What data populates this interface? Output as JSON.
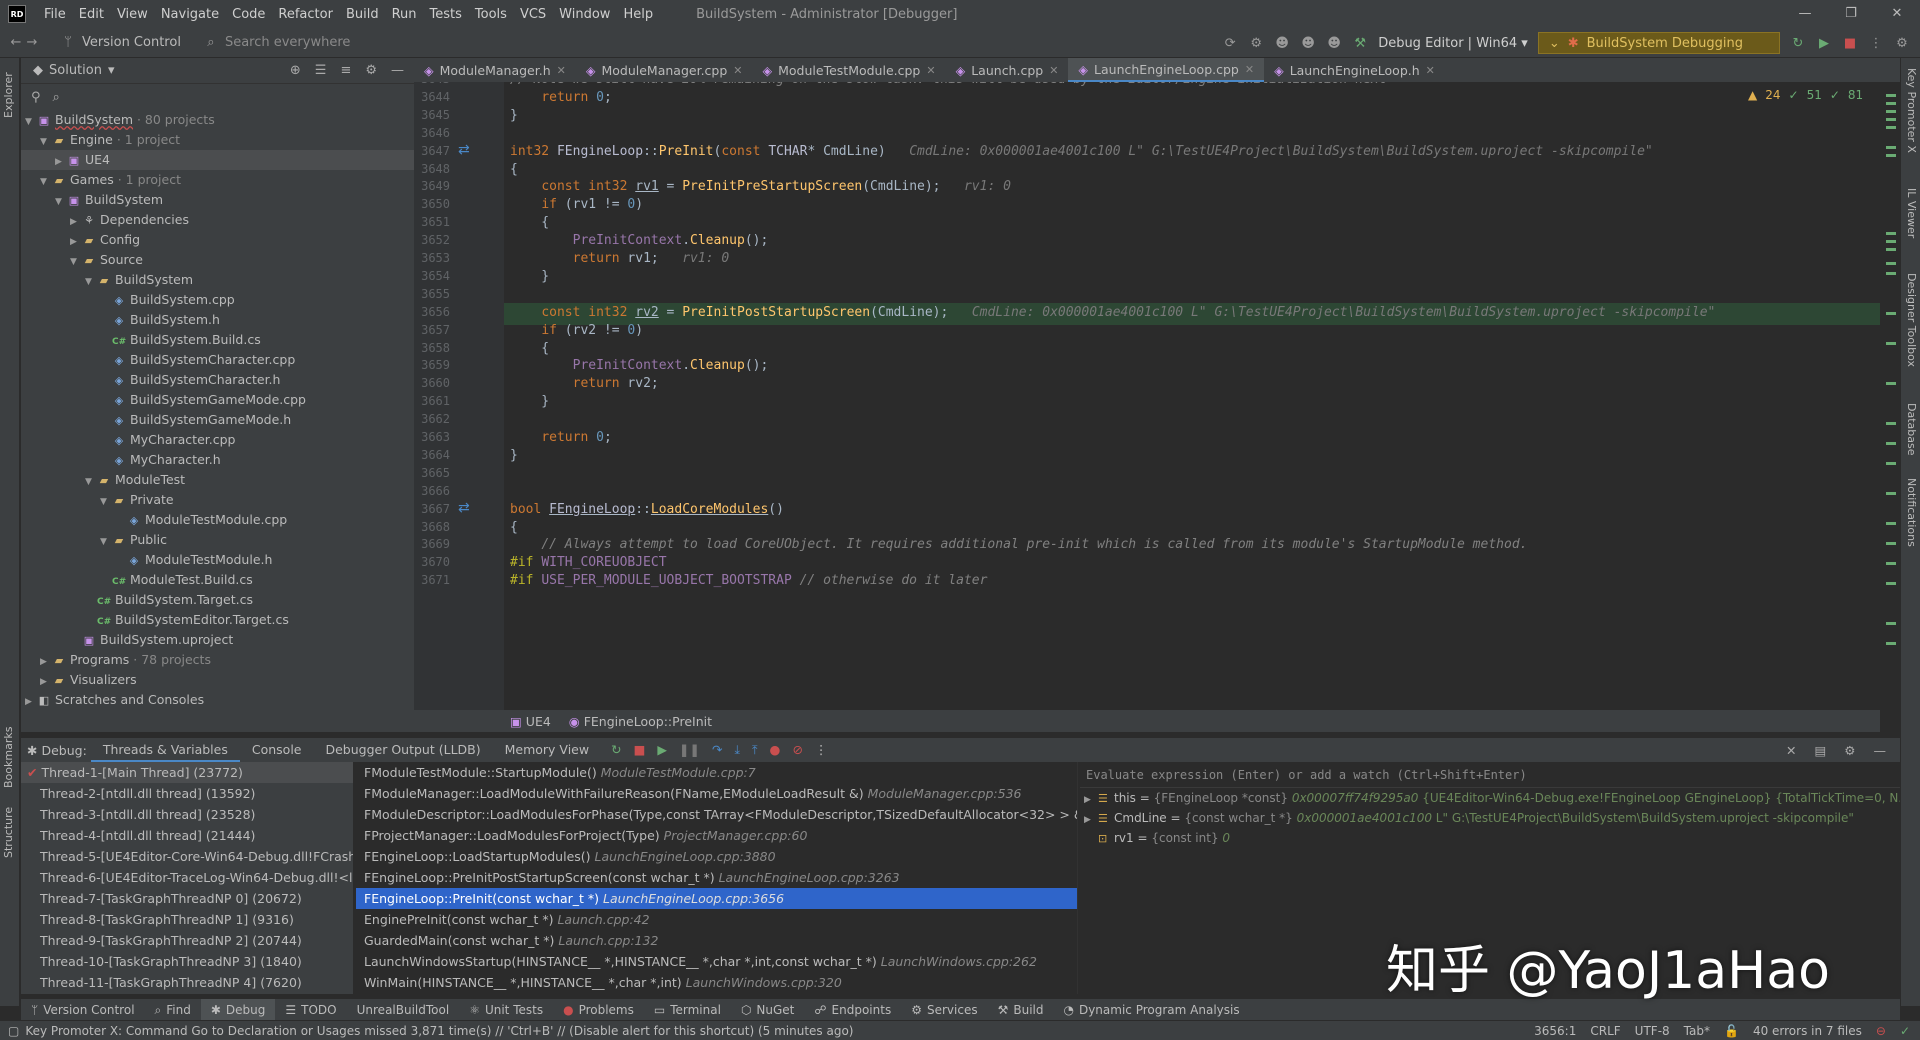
{
  "app": {
    "logo_text": "RD",
    "menu": [
      "File",
      "Edit",
      "View",
      "Navigate",
      "Code",
      "Refactor",
      "Build",
      "Run",
      "Tests",
      "Tools",
      "VCS",
      "Window",
      "Help"
    ],
    "window_title": "BuildSystem - Administrator [Debugger]",
    "win_min": "—",
    "win_max": "❐",
    "win_close": "✕"
  },
  "toolbar": {
    "version_control": "Version Control",
    "search_placeholder": "Search everywhere",
    "run_config": "Debug Editor | Win64",
    "debug_config": "BuildSystem Debugging"
  },
  "left_strip": {
    "explorer": "Explorer",
    "bookmarks": "Bookmarks",
    "structure": "Structure"
  },
  "right_strip": {
    "key_promoter": "Key Promoter X",
    "il_viewer": "IL Viewer",
    "designer": "Designer Toolbox",
    "database": "Database",
    "notifications": "Notifications"
  },
  "solution": {
    "title": "Solution",
    "tree": [
      {
        "depth": 0,
        "arrow": "v",
        "icon": "proj",
        "label": "BuildSystem",
        "hint": "· 80 projects",
        "underline": true
      },
      {
        "depth": 1,
        "arrow": "v",
        "icon": "folder",
        "label": "Engine",
        "hint": "· 1 project"
      },
      {
        "depth": 2,
        "arrow": ">",
        "icon": "proj",
        "label": "UE4",
        "hint": "",
        "selected": true
      },
      {
        "depth": 1,
        "arrow": "v",
        "icon": "folder",
        "label": "Games",
        "hint": "· 1 project"
      },
      {
        "depth": 2,
        "arrow": "v",
        "icon": "proj",
        "label": "BuildSystem",
        "hint": ""
      },
      {
        "depth": 3,
        "arrow": ">",
        "icon": "dep",
        "label": "Dependencies",
        "hint": ""
      },
      {
        "depth": 3,
        "arrow": ">",
        "icon": "folder",
        "label": "Config",
        "hint": ""
      },
      {
        "depth": 3,
        "arrow": "v",
        "icon": "folder",
        "label": "Source",
        "hint": ""
      },
      {
        "depth": 4,
        "arrow": "v",
        "icon": "folder",
        "label": "BuildSystem",
        "hint": ""
      },
      {
        "depth": 5,
        "arrow": "",
        "icon": "cpp",
        "label": "BuildSystem.cpp",
        "hint": ""
      },
      {
        "depth": 5,
        "arrow": "",
        "icon": "cpp",
        "label": "BuildSystem.h",
        "hint": ""
      },
      {
        "depth": 5,
        "arrow": "",
        "icon": "cs",
        "label": "BuildSystem.Build.cs",
        "hint": ""
      },
      {
        "depth": 5,
        "arrow": "",
        "icon": "cpp",
        "label": "BuildSystemCharacter.cpp",
        "hint": ""
      },
      {
        "depth": 5,
        "arrow": "",
        "icon": "cpp",
        "label": "BuildSystemCharacter.h",
        "hint": ""
      },
      {
        "depth": 5,
        "arrow": "",
        "icon": "cpp",
        "label": "BuildSystemGameMode.cpp",
        "hint": ""
      },
      {
        "depth": 5,
        "arrow": "",
        "icon": "cpp",
        "label": "BuildSystemGameMode.h",
        "hint": ""
      },
      {
        "depth": 5,
        "arrow": "",
        "icon": "cpp",
        "label": "MyCharacter.cpp",
        "hint": ""
      },
      {
        "depth": 5,
        "arrow": "",
        "icon": "cpp",
        "label": "MyCharacter.h",
        "hint": ""
      },
      {
        "depth": 4,
        "arrow": "v",
        "icon": "folder",
        "label": "ModuleTest",
        "hint": ""
      },
      {
        "depth": 5,
        "arrow": "v",
        "icon": "folder",
        "label": "Private",
        "hint": ""
      },
      {
        "depth": 6,
        "arrow": "",
        "icon": "cpp",
        "label": "ModuleTestModule.cpp",
        "hint": ""
      },
      {
        "depth": 5,
        "arrow": "v",
        "icon": "folder",
        "label": "Public",
        "hint": ""
      },
      {
        "depth": 6,
        "arrow": "",
        "icon": "cpp",
        "label": "ModuleTestModule.h",
        "hint": ""
      },
      {
        "depth": 5,
        "arrow": "",
        "icon": "cs",
        "label": "ModuleTest.Build.cs",
        "hint": ""
      },
      {
        "depth": 4,
        "arrow": "",
        "icon": "cs",
        "label": "BuildSystem.Target.cs",
        "hint": ""
      },
      {
        "depth": 4,
        "arrow": "",
        "icon": "cs",
        "label": "BuildSystemEditor.Target.cs",
        "hint": ""
      },
      {
        "depth": 3,
        "arrow": "",
        "icon": "proj",
        "label": "BuildSystem.uproject",
        "hint": ""
      },
      {
        "depth": 1,
        "arrow": ">",
        "icon": "folder",
        "label": "Programs",
        "hint": "· 78 projects"
      },
      {
        "depth": 1,
        "arrow": ">",
        "icon": "folder",
        "label": "Visualizers",
        "hint": ""
      },
      {
        "depth": 0,
        "arrow": ">",
        "icon": "scratch",
        "label": "Scratches and Consoles",
        "hint": ""
      }
    ]
  },
  "editor_tabs": [
    {
      "label": "ModuleManager.h",
      "active": false
    },
    {
      "label": "ModuleManager.cpp",
      "active": false
    },
    {
      "label": "ModuleTestModule.cpp",
      "active": false
    },
    {
      "label": "Launch.cpp",
      "active": false
    },
    {
      "label": "LaunchEngineLoop.cpp",
      "active": true
    },
    {
      "label": "LaunchEngineLoop.h",
      "active": false
    }
  ],
  "inspection": {
    "warnings": "24",
    "weak": "51",
    "typos": "81"
  },
  "code_lines": [
    {
      "n": "3643",
      "html": "<span class=\"cm\">// Note we still have 20% remaining on the slow task: this will be used by the Editor/Engine initialization next</span>"
    },
    {
      "n": "3644",
      "html": "    <span class=\"kw\">return</span> <span class=\"num\">0</span>;"
    },
    {
      "n": "3645",
      "html": "}"
    },
    {
      "n": "3646",
      "html": ""
    },
    {
      "n": "3647",
      "html": "<span class=\"kw\">int32</span> <span class=\"ty\">FEngineLoop</span>::<span class=\"fn\">PreInit</span>(<span class=\"kw\">const</span> <span class=\"ty\">TCHAR</span>* CmdLine)   <span class=\"hint-inline\">CmdLine: 0x000001ae4001c100 L\" G:\\TestUE4Project\\BuildSystem\\BuildSystem.uproject -skipcompile\"</span>"
    },
    {
      "n": "3648",
      "html": "{"
    },
    {
      "n": "3649",
      "html": "    <span class=\"kw\">const</span> <span class=\"kw\">int32</span> <u>rv1</u> = <span class=\"fn\">PreInitPreStartupScreen</span>(CmdLine);   <span class=\"hint-inline\">rv1: 0</span>"
    },
    {
      "n": "3650",
      "html": "    <span class=\"kw\">if</span> (rv1 != <span class=\"num\">0</span>)"
    },
    {
      "n": "3651",
      "html": "    {"
    },
    {
      "n": "3652",
      "html": "        <span class=\"mc\">PreInitContext</span>.<span class=\"fn\">Cleanup</span>();"
    },
    {
      "n": "3653",
      "html": "        <span class=\"kw\">return</span> rv1;   <span class=\"hint-inline\">rv1: 0</span>"
    },
    {
      "n": "3654",
      "html": "    }"
    },
    {
      "n": "3655",
      "html": ""
    },
    {
      "n": "3656",
      "html": "    <span class=\"kw\">const</span> <span class=\"kw\">int32</span> <u>rv2</u> = <span class=\"fn\">PreInitPostStartupScreen</span>(CmdLine);   <span class=\"hint-inline\">CmdLine: 0x000001ae4001c100 L\" G:\\TestUE4Project\\BuildSystem\\BuildSystem.uproject -skipcompile\"</span>",
      "current": true
    },
    {
      "n": "3657",
      "html": "    <span class=\"kw\">if</span> (rv2 != <span class=\"num\">0</span>)"
    },
    {
      "n": "3658",
      "html": "    {"
    },
    {
      "n": "3659",
      "html": "        <span class=\"mc\">PreInitContext</span>.<span class=\"fn\">Cleanup</span>();"
    },
    {
      "n": "3660",
      "html": "        <span class=\"kw\">return</span> rv2;"
    },
    {
      "n": "3661",
      "html": "    }"
    },
    {
      "n": "3662",
      "html": ""
    },
    {
      "n": "3663",
      "html": "    <span class=\"kw\">return</span> <span class=\"num\">0</span>;"
    },
    {
      "n": "3664",
      "html": "}"
    },
    {
      "n": "3665",
      "html": ""
    },
    {
      "n": "3666",
      "html": ""
    },
    {
      "n": "3667",
      "html": "<span class=\"kw\">bool</span> <u><span class=\"ty\">FEngineLoop</span></u>::<u><span class=\"fn\">LoadCoreModules</span></u>()"
    },
    {
      "n": "3668",
      "html": "{"
    },
    {
      "n": "3669",
      "html": "    <span class=\"cm\">// Always attempt to load CoreUObject. It requires additional pre-init which is called from its module's StartupModule method.</span>"
    },
    {
      "n": "3670",
      "html": "<span class=\"pp\">#if</span> <span class=\"mc\">WITH_COREUOBJECT</span>"
    },
    {
      "n": "3671",
      "html": "<span class=\"pp\">#if</span> <span class=\"mc\">USE_PER_MODULE_UOBJECT_BOOTSTRAP</span> <span class=\"cm\">// otherwise do it later</span>"
    }
  ],
  "breadcrumb": {
    "project": "UE4",
    "function": "FEngineLoop::PreInit"
  },
  "debug": {
    "label": "Debug:",
    "tabs": [
      "Threads & Variables",
      "Console",
      "Debugger Output (LLDB)",
      "Memory View"
    ],
    "threads": [
      "Thread-1-[Main Thread] (23772)",
      "Thread-2-[ntdll.dll thread] (13592)",
      "Thread-3-[ntdll.dll thread] (23528)",
      "Thread-4-[ntdll.dll thread] (21444)",
      "Thread-5-[UE4Editor-Core-Win64-Debug.dll!FCrashRe",
      "Thread-6-[UE4Editor-TraceLog-Win64-Debug.dll!<lar",
      "Thread-7-[TaskGraphThreadNP 0] (20672)",
      "Thread-8-[TaskGraphThreadNP 1] (9316)",
      "Thread-9-[TaskGraphThreadNP 2] (20744)",
      "Thread-10-[TaskGraphThreadNP 3] (1840)",
      "Thread-11-[TaskGraphThreadNP 4] (7620)"
    ],
    "frames": [
      {
        "fn": "FModuleTestModule::StartupModule()",
        "loc": "ModuleTestModule.cpp:7"
      },
      {
        "fn": "FModuleManager::LoadModuleWithFailureReason(FName,EModuleLoadResult &)",
        "loc": "ModuleManager.cpp:536"
      },
      {
        "fn": "FModuleDescriptor::LoadModulesForPhase(Type,const TArray<FModuleDescriptor,TSizedDefaultAllocator<32> > &,TMap",
        "loc": ""
      },
      {
        "fn": "FProjectManager::LoadModulesForProject(Type)",
        "loc": "ProjectManager.cpp:60"
      },
      {
        "fn": "FEngineLoop::LoadStartupModules()",
        "loc": "LaunchEngineLoop.cpp:3880"
      },
      {
        "fn": "FEngineLoop::PreInitPostStartupScreen(const wchar_t *)",
        "loc": "LaunchEngineLoop.cpp:3263"
      },
      {
        "fn": "FEngineLoop::PreInit(const wchar_t *)",
        "loc": "LaunchEngineLoop.cpp:3656",
        "selected": true
      },
      {
        "fn": "EnginePreInit(const wchar_t *)",
        "loc": "Launch.cpp:42"
      },
      {
        "fn": "GuardedMain(const wchar_t *)",
        "loc": "Launch.cpp:132"
      },
      {
        "fn": "LaunchWindowsStartup(HINSTANCE__ *,HINSTANCE__ *,char *,int,const wchar_t *)",
        "loc": "LaunchWindows.cpp:262"
      },
      {
        "fn": "WinMain(HINSTANCE__ *,HINSTANCE__ *,char *,int)",
        "loc": "LaunchWindows.cpp:320"
      }
    ],
    "eval_placeholder": "Evaluate expression (Enter) or add a watch (Ctrl+Shift+Enter)",
    "variables": [
      {
        "arrow": ">",
        "name": "this",
        "type": "{FEngineLoop *const}",
        "value": "0x00007ff74f9295a0",
        "extra": "{UE4Editor-Win64-Debug.exe!FEngineLoop GEngineLoop} {TotalTickTime=0, N...",
        "link": "View"
      },
      {
        "arrow": ">",
        "name": "CmdLine",
        "type": "{const wchar_t *}",
        "value": "0x000001ae4001c100",
        "extra": "L\" G:\\TestUE4Project\\BuildSystem\\BuildSystem.uproject -skipcompile\"",
        "link": ""
      },
      {
        "arrow": "",
        "name": "rv1",
        "type": "{const int}",
        "value": "0",
        "extra": "",
        "link": ""
      }
    ]
  },
  "bottom_tabs": [
    "Version Control",
    "Find",
    "Debug",
    "TODO",
    "UnrealBuildTool",
    "Unit Tests",
    "Problems",
    "Terminal",
    "NuGet",
    "Endpoints",
    "Services",
    "Build",
    "Dynamic Program Analysis"
  ],
  "status": {
    "message": "Key Promoter X: Command Go to Declaration or Usages missed 3,871 time(s) // 'Ctrl+B' // (Disable alert for this shortcut) (5 minutes ago)",
    "position": "3656:1",
    "line_sep": "CRLF",
    "encoding": "UTF-8",
    "indent": "Tab*",
    "errors": "40 errors in 7 files"
  },
  "watermark": "知乎 @YaoJ1aHao",
  "colors": {
    "accent": "#4a88c7",
    "selection": "#2f65ca",
    "debug_config_bg": "#6b5a1a",
    "current_line": "#2d4734"
  }
}
